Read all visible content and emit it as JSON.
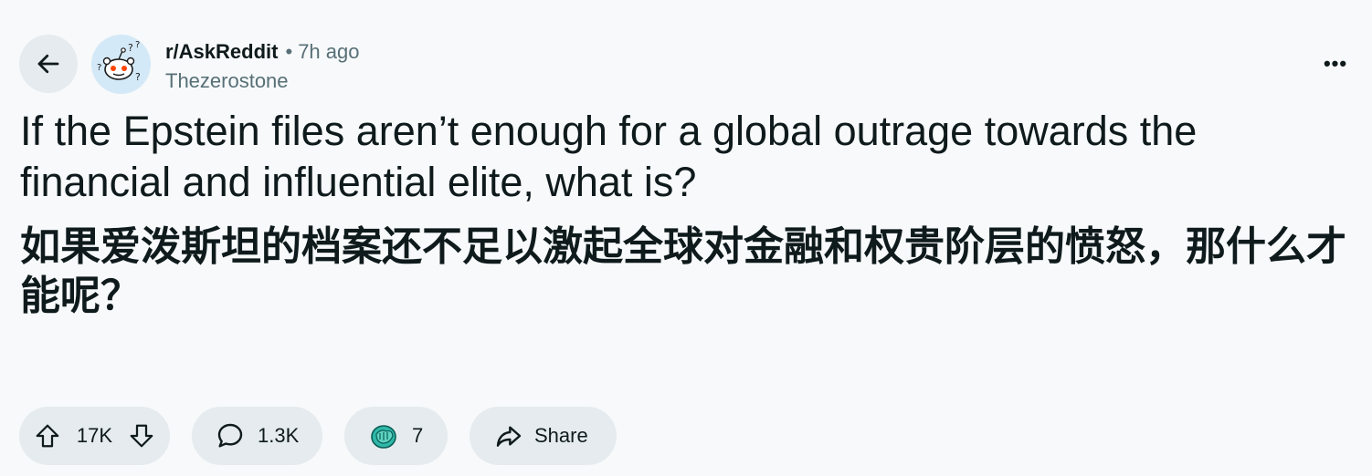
{
  "post": {
    "subreddit": "r/AskReddit",
    "separator": "•",
    "time_ago": "7h ago",
    "author": "Thezerostone",
    "title_en": "If the Epstein files aren’t enough for a global outrage towards the financial and influential elite, what is?",
    "title_zh": "如果爱泼斯坦的档案还不足以激起全球对金融和权贵阶层的愤怒，那什么才能呢？"
  },
  "header": {
    "back_icon": "arrow-left-icon",
    "more_label": "•••"
  },
  "actions": {
    "upvotes": "17K",
    "comments": "1.3K",
    "awards": "7",
    "share_label": "Share"
  },
  "colors": {
    "background": "#f7f9fa",
    "pill_bg": "#e5ebee",
    "text_primary": "#0f1a1c",
    "text_secondary": "#576f76"
  }
}
